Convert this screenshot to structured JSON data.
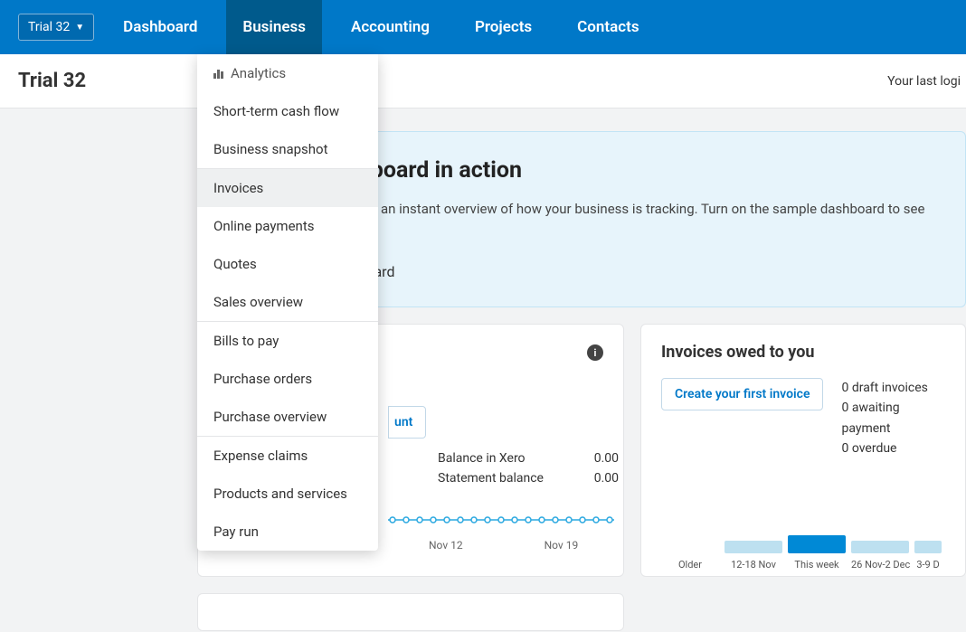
{
  "org_name": "Trial 32",
  "nav": {
    "dashboard": "Dashboard",
    "business": "Business",
    "accounting": "Accounting",
    "projects": "Projects",
    "contacts": "Contacts"
  },
  "subheader": {
    "title": "Trial 32",
    "last_login": "Your last logi"
  },
  "business_menu": {
    "analytics": "Analytics",
    "cashflow": "Short-term cash flow",
    "snapshot": "Business snapshot",
    "invoices": "Invoices",
    "online_payments": "Online payments",
    "quotes": "Quotes",
    "sales_overview": "Sales overview",
    "bills": "Bills to pay",
    "purchase_orders": "Purchase orders",
    "purchase_overview": "Purchase overview",
    "expense_claims": "Expense claims",
    "products": "Products and services",
    "payrun": "Pay run"
  },
  "banner": {
    "title": "See your dashboard in action",
    "body": "The dashboard gives you an instant overview of how your business is tracking. Turn on the sample dashboard to see how yours could look.",
    "toggle_label": "Sample dashboard"
  },
  "balance_card": {
    "button_partial": "unt",
    "balance_xero_label": "Balance in Xero",
    "balance_xero_value": "0.00",
    "stmt_label": "Statement balance",
    "stmt_value": "0.00",
    "dates": [
      "Nov 12",
      "Nov 19"
    ]
  },
  "invoices_card": {
    "title": "Invoices owed to you",
    "cta": "Create your first invoice",
    "lines": [
      "0 draft invoices",
      "0 awaiting payment",
      "0 overdue"
    ],
    "bar_labels": [
      "Older",
      "12-18 Nov",
      "This week",
      "26 Nov-2 Dec",
      "3-9 D"
    ]
  }
}
